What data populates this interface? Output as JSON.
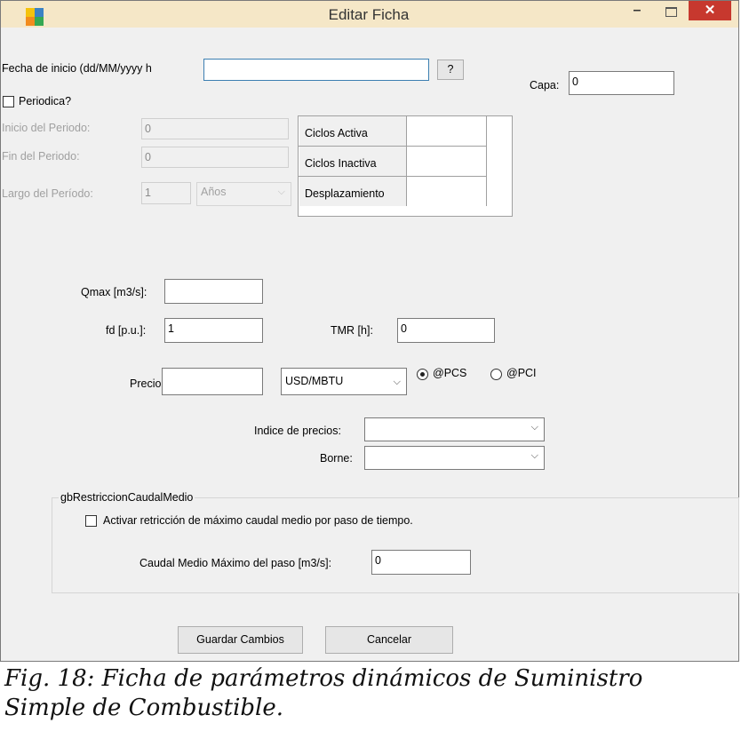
{
  "window": {
    "title": "Editar Ficha",
    "minimize_glyph": "–",
    "close_glyph": "✕",
    "icon_colors": [
      "#f4c20d",
      "#3b82c4",
      "#f28c1e",
      "#35a853"
    ]
  },
  "fecha": {
    "label": "Fecha de inicio (dd/MM/yyyy h",
    "value": "",
    "help_button": "?"
  },
  "capa": {
    "label": "Capa:",
    "value": "0"
  },
  "periodica": {
    "label": "Periodica?",
    "checked": false
  },
  "periodo": {
    "inicio_label": "Inicio del Periodo:",
    "inicio_value": "0",
    "fin_label": "Fin del Periodo:",
    "fin_value": "0",
    "largo_label": "Largo del Período:",
    "largo_value": "1",
    "unidad": "Años"
  },
  "ciclos_grid": [
    {
      "label": "Ciclos Activa",
      "value": ""
    },
    {
      "label": "Ciclos Inactiva",
      "value": ""
    },
    {
      "label": "Desplazamiento",
      "value": ""
    }
  ],
  "qmax": {
    "label": "Qmax [m3/s]:",
    "value": ""
  },
  "fd": {
    "label": "fd [p.u.]:",
    "value": "1"
  },
  "tmr": {
    "label": "TMR [h]:",
    "value": "0"
  },
  "precio": {
    "label": "Precio:",
    "value": "",
    "unidad": "USD/MBTU",
    "radio_pcs": "@PCS",
    "radio_pci": "@PCI",
    "selected": "@PCS"
  },
  "indice": {
    "label": "Indice de precios:",
    "value": ""
  },
  "borne": {
    "label": "Borne:",
    "value": ""
  },
  "restriccion": {
    "group_title": "gbRestriccionCaudalMedio",
    "checkbox_label": "Activar retricción de máximo caudal medio por paso de tiempo.",
    "checked": false,
    "caudal_label": "Caudal Medio Máximo del paso [m3/s]:",
    "caudal_value": "0"
  },
  "buttons": {
    "guardar": "Guardar Cambios",
    "cancelar": "Cancelar"
  },
  "caption": {
    "line1": "Fig. 18: Ficha de parámetros dinámicos de Suministro",
    "line2": "Simple de Combustible."
  }
}
